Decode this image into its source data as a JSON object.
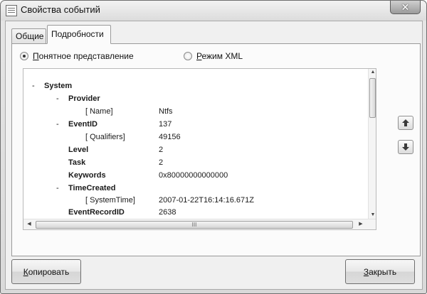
{
  "window": {
    "title": "Свойства событий",
    "close_glyph": "✕"
  },
  "tabs": [
    {
      "label": "Общие"
    },
    {
      "label": "Подробности"
    }
  ],
  "view_options": {
    "friendly": {
      "underline_char": "П",
      "rest": "онятное представление",
      "checked": true
    },
    "xml": {
      "underline_char": "Р",
      "rest": "ежим XML",
      "checked": false
    }
  },
  "tree": {
    "rows": [
      {
        "toggle": "-",
        "key": "System",
        "value": ""
      },
      {
        "toggle": "-",
        "key": "Provider",
        "value": ""
      },
      {
        "toggle": "",
        "key": "[ Name]",
        "value": "Ntfs"
      },
      {
        "toggle": "-",
        "key": "EventID",
        "value": "137"
      },
      {
        "toggle": "",
        "key": "[ Qualifiers]",
        "value": "49156"
      },
      {
        "toggle": "",
        "key": "Level",
        "value": "2"
      },
      {
        "toggle": "",
        "key": "Task",
        "value": "2"
      },
      {
        "toggle": "",
        "key": "Keywords",
        "value": "0x80000000000000"
      },
      {
        "toggle": "-",
        "key": "TimeCreated",
        "value": ""
      },
      {
        "toggle": "",
        "key": "[ SystemTime]",
        "value": "2007-01-22T16:14:16.671Z"
      },
      {
        "toggle": "",
        "key": "EventRecordID",
        "value": "2638"
      }
    ]
  },
  "scroll": {
    "h_thumb_grip": "III",
    "up_arrow": "▲",
    "down_arrow": "▼",
    "left_arrow": "◀",
    "right_arrow": "▶"
  },
  "buttons": {
    "copy": {
      "underline_char": "К",
      "rest": "опировать"
    },
    "close": {
      "underline_char": "З",
      "rest": "акрыть"
    }
  },
  "icons": {
    "move_up": "arrow-up-icon",
    "move_down": "arrow-down-icon"
  }
}
